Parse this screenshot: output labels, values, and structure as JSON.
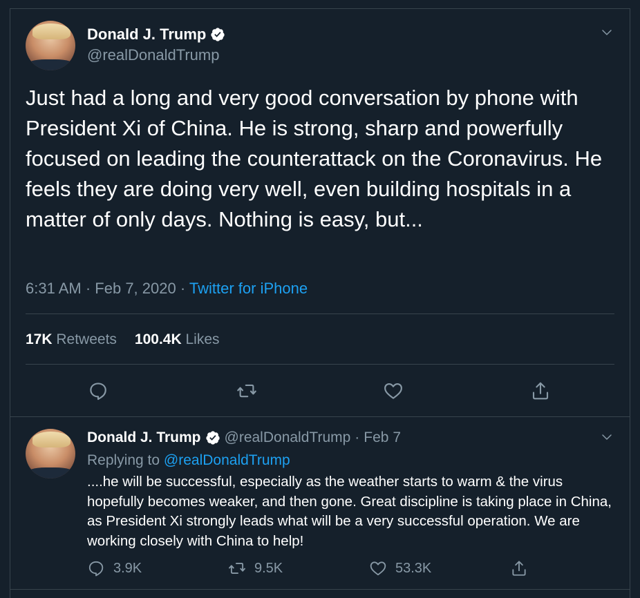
{
  "main_tweet": {
    "author_name": "Donald J. Trump",
    "handle": "@realDonaldTrump",
    "text": "Just had a long and very good conversation by phone with President Xi of China. He is strong, sharp and powerfully focused on leading the counterattack on the Coronavirus. He feels they are doing very well, even building hospitals in a matter of only days. Nothing is easy, but...",
    "time": "6:31 AM",
    "dot": "·",
    "date": "Feb 7, 2020",
    "source": "Twitter for iPhone",
    "retweets_count": "17K",
    "retweets_label": "Retweets",
    "likes_count": "100.4K",
    "likes_label": "Likes"
  },
  "reply_tweet": {
    "author_name": "Donald J. Trump",
    "handle": "@realDonaldTrump",
    "dot": "·",
    "date": "Feb 7",
    "replying_label": "Replying to",
    "replying_to": "@realDonaldTrump",
    "text": "....he will be successful, especially as the weather starts to warm & the virus hopefully becomes weaker, and then gone. Great discipline is taking place in China, as President Xi strongly leads what will be a very successful operation. We are working closely with China to help!",
    "reply_count": "3.9K",
    "retweet_count": "9.5K",
    "like_count": "53.3K"
  },
  "icons": [
    "verified-badge-icon",
    "chevron-down-icon",
    "reply-icon",
    "retweet-icon",
    "like-icon",
    "share-icon"
  ],
  "colors": {
    "background": "#15202b",
    "border": "#38444d",
    "secondary_text": "#8899a6",
    "link": "#1da1f2"
  }
}
